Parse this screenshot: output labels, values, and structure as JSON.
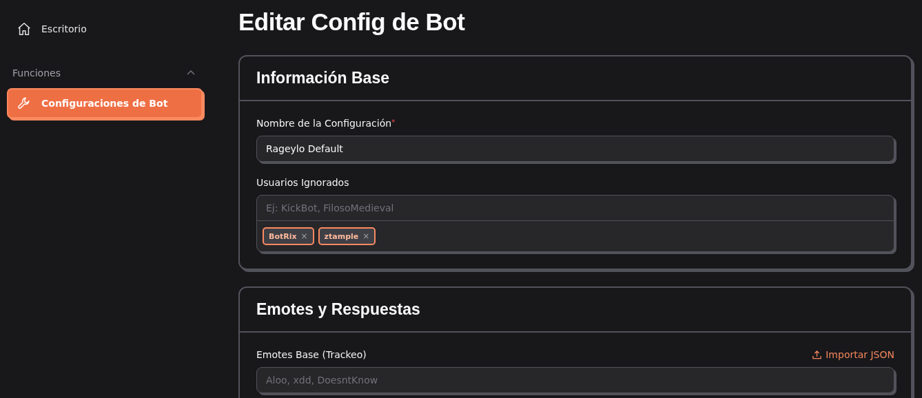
{
  "sidebar": {
    "items": [
      {
        "label": "Escritorio",
        "kind": "home",
        "selected": false
      }
    ],
    "groups": [
      {
        "title": "Funciones",
        "expanded": true,
        "items": [
          {
            "label": "Configuraciones de Bot",
            "kind": "wrench",
            "selected": true
          }
        ]
      }
    ]
  },
  "page_title": "Editar Config de Bot",
  "sections": [
    {
      "title": "Información Base",
      "fields": [
        {
          "kind": "text",
          "label": "Nombre de la Configuración",
          "required_mark": "*",
          "value": "Rageylo Default"
        },
        {
          "kind": "tags",
          "label": "Usuarios Ignorados",
          "placeholder": "Ej: KickBot, FilosoMedieval",
          "tags": [
            {
              "label": "BotRix",
              "remove": "×"
            },
            {
              "label": "ztample",
              "remove": "×"
            }
          ]
        }
      ]
    },
    {
      "title": "Emotes y Respuestas",
      "fields": [
        {
          "kind": "text",
          "label": "Emotes Base (Trackeo)",
          "placeholder": "Aloo, xdd, DoesntKnow",
          "action": "Importar JSON"
        }
      ]
    }
  ]
}
